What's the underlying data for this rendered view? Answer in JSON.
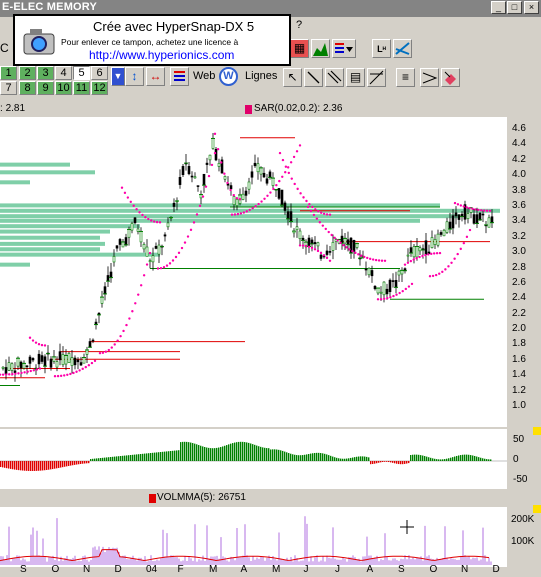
{
  "window": {
    "title": "E-ELEC MEMORY",
    "controls": [
      "_",
      "□",
      "×"
    ]
  },
  "menu": {
    "help": "?"
  },
  "stamp": {
    "line1": "Crée avec HyperSnap-DX 5",
    "line2": "Pour enlever ce tampon, achetez une licence à",
    "line3": "http://www.hyperionics.com"
  },
  "toolbar": {
    "code_fragment": "C N",
    "periods_row1": [
      "2",
      "3",
      "4",
      "5",
      "6"
    ],
    "periods_row2": [
      "8",
      "9",
      "10",
      "11",
      "12"
    ],
    "web_label": "Web",
    "lines_label": "Lignes"
  },
  "main_chart": {
    "value_left": "2.81",
    "sar_label": "SAR(0.02,0.2):",
    "sar_value": "2.36",
    "y_ticks": [
      "4.6",
      "4.4",
      "4.2",
      "4.0",
      "3.8",
      "3.6",
      "3.4",
      "3.2",
      "3.0",
      "2.8",
      "2.6",
      "2.4",
      "2.2",
      "2.0",
      "1.8",
      "1.6",
      "1.4",
      "1.2",
      "1.0"
    ]
  },
  "oscillator": {
    "y_ticks": [
      "50",
      "0",
      "-50"
    ]
  },
  "volume": {
    "label": "VOLMMA(5):",
    "value": "26751",
    "y_ticks": [
      "200K",
      "100K"
    ]
  },
  "x_axis": {
    "labels": [
      "S",
      "O",
      "N",
      "D",
      "04",
      "F",
      "M",
      "A",
      "M",
      "J",
      "J",
      "A",
      "S",
      "O",
      "N",
      "D"
    ]
  },
  "colors": {
    "up": "#008000",
    "down": "#e00000",
    "sar": "#ff00aa",
    "volume_profile": "#7fcfa8",
    "resistance": "#e00000",
    "support": "#008000"
  },
  "chart_data": [
    {
      "type": "line",
      "title": "",
      "series": [
        {
          "name": "SAR(0.02,0.2)",
          "x": [
            0,
            1,
            2,
            3,
            4,
            5,
            6,
            7,
            8,
            9,
            10,
            11,
            12,
            13,
            14,
            15
          ],
          "values": [
            1.6,
            1.5,
            1.55,
            2.8,
            3.6,
            3.9,
            4.2,
            3.8,
            3.3,
            2.9,
            3.2,
            2.6,
            2.5,
            2.7,
            3.2,
            3.5
          ]
        },
        {
          "name": "",
          "x": [
            0,
            1,
            2,
            3,
            4,
            5,
            6,
            7,
            8,
            9,
            10,
            11,
            12,
            13,
            14,
            15
          ],
          "values": [
            1.5,
            1.7,
            1.7,
            3.5,
            3.2,
            4.0,
            4.3,
            3.6,
            3.1,
            2.9,
            3.1,
            2.4,
            2.6,
            3.1,
            3.4,
            3.4
          ]
        }
      ],
      "ylim": [
        1.0,
        4.7
      ],
      "y_ticks": [
        1.0,
        1.2,
        1.4,
        1.6,
        1.8,
        2.0,
        2.2,
        2.4,
        2.6,
        2.8,
        3.0,
        3.2,
        3.4,
        3.6,
        3.8,
        4.0,
        4.2,
        4.4,
        4.6
      ]
    },
    {
      "type": "bar",
      "title": "",
      "ylim": [
        -60,
        60
      ],
      "y_ticks": [
        50,
        0,
        -50
      ],
      "values": [
        -20,
        -15,
        -10,
        -5,
        5,
        15,
        30,
        25,
        20,
        10,
        5,
        -2,
        -5,
        3,
        8,
        10
      ]
    },
    {
      "type": "bar",
      "title": "",
      "series": [
        {
          "name": "VOLMMA(5)",
          "values": [
            20000,
            25000,
            30000,
            40000,
            60000,
            90000,
            70000,
            60000,
            50000,
            30000,
            40000,
            30000,
            25000,
            35000,
            60000,
            26751
          ]
        }
      ],
      "ylim": [
        0,
        230000
      ],
      "y_ticks": [
        100000,
        200000
      ]
    }
  ]
}
